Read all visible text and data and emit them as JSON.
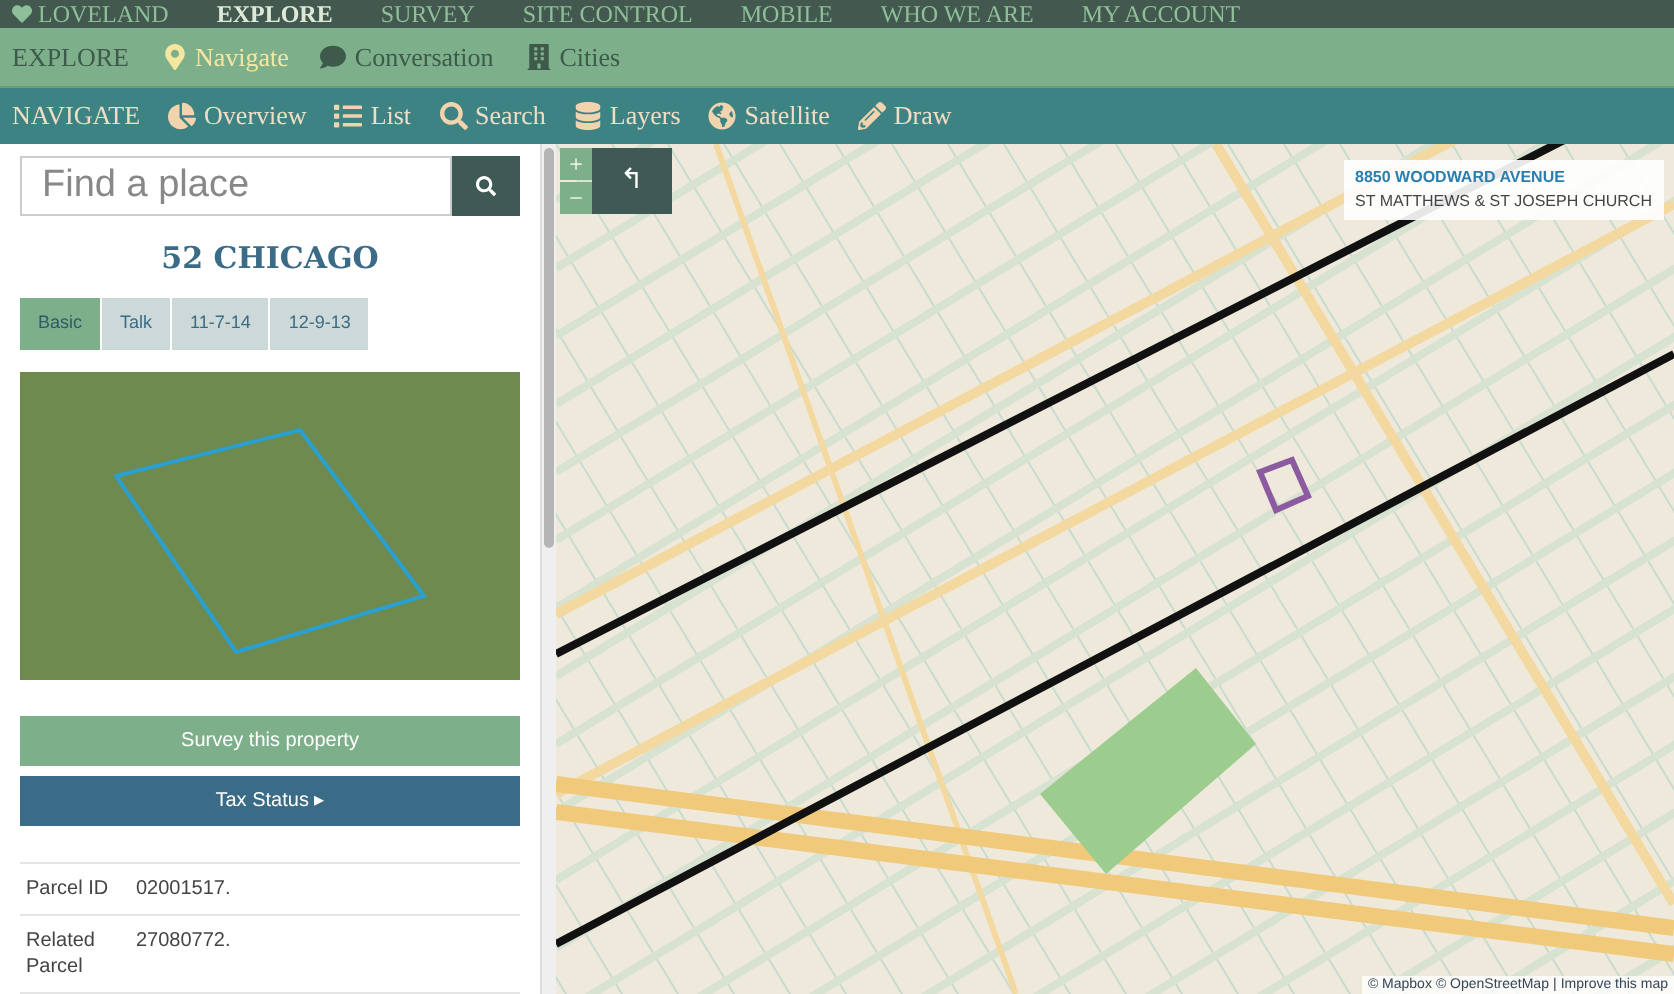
{
  "top_nav": {
    "brand": "LOVELAND",
    "items": [
      {
        "label": "EXPLORE",
        "selected": true
      },
      {
        "label": "SURVEY",
        "selected": false
      },
      {
        "label": "SITE CONTROL",
        "selected": false
      },
      {
        "label": "MOBILE",
        "selected": false
      },
      {
        "label": "WHO WE ARE",
        "selected": false
      },
      {
        "label": "MY ACCOUNT",
        "selected": false
      }
    ]
  },
  "explore_bar": {
    "title": "EXPLORE",
    "items": [
      {
        "label": "Navigate",
        "selected": true
      },
      {
        "label": "Conversation",
        "selected": false
      },
      {
        "label": "Cities",
        "selected": false
      }
    ]
  },
  "navigate_bar": {
    "title": "NAVIGATE",
    "items": [
      {
        "label": "Overview"
      },
      {
        "label": "List"
      },
      {
        "label": "Search"
      },
      {
        "label": "Layers"
      },
      {
        "label": "Satellite"
      },
      {
        "label": "Draw"
      }
    ]
  },
  "search": {
    "placeholder": "Find a place"
  },
  "property": {
    "title": "52 CHICAGO",
    "tabs": [
      {
        "label": "Basic",
        "selected": true
      },
      {
        "label": "Talk",
        "selected": false
      },
      {
        "label": "11-7-14",
        "selected": false
      },
      {
        "label": "12-9-13",
        "selected": false
      }
    ],
    "survey_button": "Survey this property",
    "tax_button": "Tax Status",
    "tax_caret": "▸",
    "details": [
      {
        "label": "Parcel ID",
        "value": "02001517."
      },
      {
        "label": "Related Parcel",
        "value": "27080772."
      }
    ]
  },
  "map": {
    "zoom_in": "+",
    "zoom_out": "−",
    "back": "↰",
    "info": {
      "address": "8850 WOODWARD AVENUE",
      "name": "ST MATTHEWS & ST JOSEPH CHURCH"
    },
    "attribution": {
      "mapbox": "© Mapbox",
      "osm": "© OpenStreetMap",
      "separator": "|",
      "improve": "Improve this map"
    }
  }
}
